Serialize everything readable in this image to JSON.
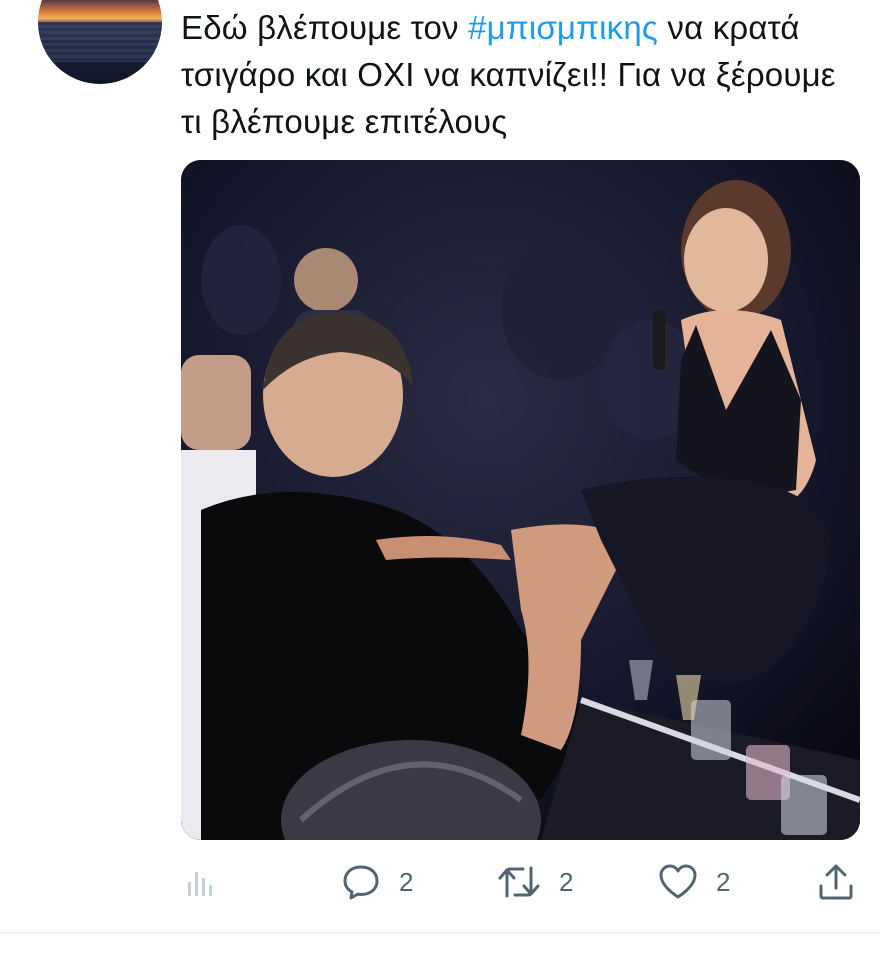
{
  "tweet": {
    "text_before": "Εδώ βλέπουμε τον ",
    "hashtag": "#μπισμπικης",
    "text_after": " να κρατά τσιγάρο και ΟΧΙ να καπνίζει!! Για να ξέρουμε τι βλέπουμε επιτέλους"
  },
  "actions": {
    "views_icon": "bar-chart-icon",
    "replies": {
      "icon": "speech-bubble-icon",
      "count": "2"
    },
    "retweets": {
      "icon": "retweet-icon",
      "count": "2"
    },
    "likes": {
      "icon": "heart-icon",
      "count": "2"
    },
    "share_icon": "share-icon"
  },
  "colors": {
    "hashtag": "#1d9bf0",
    "icon_gray": "#536471",
    "views_gray": "#c4cfd6"
  }
}
